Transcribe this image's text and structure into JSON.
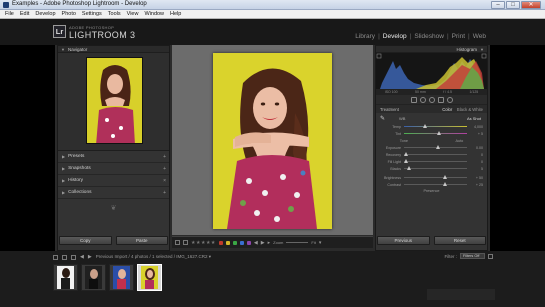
{
  "window": {
    "title": "Examples - Adobe Photoshop Lightroom - Develop",
    "controls": [
      "–",
      "□",
      "✕"
    ]
  },
  "menu": [
    "File",
    "Edit",
    "Develop",
    "Photo",
    "Settings",
    "Tools",
    "View",
    "Window",
    "Help"
  ],
  "identity": {
    "badge": "Lr",
    "brand_small": "ADOBE PHOTOSHOP",
    "brand_big": "LIGHTROOM 3",
    "modules": [
      "Library",
      "Develop",
      "Slideshow",
      "Print",
      "Web"
    ],
    "active_module": "Develop"
  },
  "left_panel": {
    "navigator_label": "Navigator",
    "sections": [
      "Presets",
      "Snapshots",
      "History",
      "Collections"
    ],
    "copy_button": "Copy",
    "paste_button": "Paste"
  },
  "right_panel": {
    "histogram_label": "Histogram",
    "hist_info": [
      "ISO 100",
      "50 mm",
      "f / 4.5",
      "1/125"
    ],
    "basic": {
      "treatment_label": "Treatment",
      "color_option": "Color",
      "bw_option": "Black & White",
      "wb_label": "WB",
      "wb_value": "As Shot",
      "temp_label": "Temp",
      "temp_value": "4,000",
      "tint_label": "Tint",
      "tint_value": "+ 5",
      "tone_label": "Tone",
      "auto_label": "Auto",
      "exposure_label": "Exposure",
      "exposure_value": "0.00",
      "recovery_label": "Recovery",
      "recovery_value": "0",
      "fill_label": "Fill Light",
      "fill_value": "0",
      "blacks_label": "Blacks",
      "blacks_value": "5",
      "brightness_label": "Brightness",
      "brightness_value": "+ 50",
      "contrast_label": "Contrast",
      "contrast_value": "+ 25",
      "presence_label": "Presence"
    },
    "previous_button": "Previous",
    "reset_button": "Reset"
  },
  "toolbar": {
    "stars": "★★★★★",
    "zoom_label": "Zoom",
    "fit_label": "Fit",
    "colors": [
      "#c0392b",
      "#d4b82a",
      "#3aa845",
      "#3a6fd1",
      "#8e44ad"
    ]
  },
  "filmstrip": {
    "source_text": "Previous Import / 4 photos / 1 selected / IMG_1627.CR2 ▾",
    "filter_label": "Filter :",
    "filter_value": "Filters Off"
  },
  "colors": {
    "backdrop": "#d9d22c",
    "active_module": "#ececec",
    "panel": "#333333"
  }
}
